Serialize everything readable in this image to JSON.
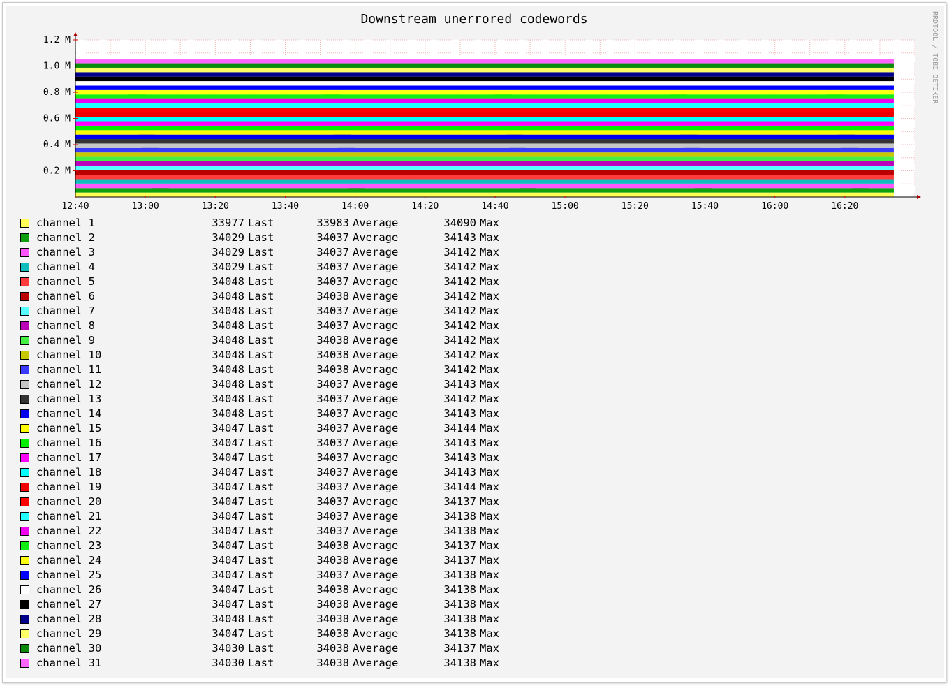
{
  "chart_data": {
    "type": "area",
    "title": "Downstream unerrored codewords",
    "side_label": "RRDTOOL / TOBI OETIKER",
    "y_ticks": [
      "1.2 M",
      "1.0 M",
      "0.8 M",
      "0.6 M",
      "0.4 M",
      "0.2 M"
    ],
    "x_ticks": [
      "12:40",
      "13:00",
      "13:20",
      "13:40",
      "14:00",
      "14:20",
      "14:40",
      "15:00",
      "15:20",
      "15:40",
      "16:00",
      "16:20"
    ],
    "ylim": [
      0,
      1200000
    ],
    "xlim": [
      "12:40",
      "16:40"
    ],
    "data_end": "16:34",
    "stacked": true,
    "grid": true,
    "legend_position": "bottom",
    "stat_labels": {
      "last": "Last",
      "average": "Average",
      "max": "Max"
    },
    "series": [
      {
        "name": "channel 1",
        "color": "#ffff55",
        "last": 33977,
        "average": 33983,
        "max": 34090
      },
      {
        "name": "channel 2",
        "color": "#0ca00c",
        "last": 34029,
        "average": 34037,
        "max": 34143
      },
      {
        "name": "channel 3",
        "color": "#ff55ff",
        "last": 34029,
        "average": 34037,
        "max": 34142
      },
      {
        "name": "channel 4",
        "color": "#10bcbc",
        "last": 34029,
        "average": 34037,
        "max": 34142
      },
      {
        "name": "channel 5",
        "color": "#ff3b3b",
        "last": 34048,
        "average": 34037,
        "max": 34142
      },
      {
        "name": "channel 6",
        "color": "#bb0000",
        "last": 34048,
        "average": 34038,
        "max": 34142
      },
      {
        "name": "channel 7",
        "color": "#55ffff",
        "last": 34048,
        "average": 34037,
        "max": 34142
      },
      {
        "name": "channel 8",
        "color": "#bb00bb",
        "last": 34048,
        "average": 34037,
        "max": 34142
      },
      {
        "name": "channel 9",
        "color": "#44ee44",
        "last": 34048,
        "average": 34038,
        "max": 34142
      },
      {
        "name": "channel 10",
        "color": "#c8c800",
        "last": 34048,
        "average": 34038,
        "max": 34142
      },
      {
        "name": "channel 11",
        "color": "#3a3aff",
        "last": 34048,
        "average": 34038,
        "max": 34142
      },
      {
        "name": "channel 12",
        "color": "#c6c6c6",
        "last": 34048,
        "average": 34037,
        "max": 34143
      },
      {
        "name": "channel 13",
        "color": "#333333",
        "last": 34048,
        "average": 34037,
        "max": 34142
      },
      {
        "name": "channel 14",
        "color": "#0000ee",
        "last": 34048,
        "average": 34037,
        "max": 34143
      },
      {
        "name": "channel 15",
        "color": "#ffff00",
        "last": 34047,
        "average": 34037,
        "max": 34144
      },
      {
        "name": "channel 16",
        "color": "#00ee00",
        "last": 34047,
        "average": 34037,
        "max": 34143
      },
      {
        "name": "channel 17",
        "color": "#ff00ff",
        "last": 34047,
        "average": 34037,
        "max": 34143
      },
      {
        "name": "channel 18",
        "color": "#00ffff",
        "last": 34047,
        "average": 34037,
        "max": 34143
      },
      {
        "name": "channel 19",
        "color": "#ee0000",
        "last": 34047,
        "average": 34037,
        "max": 34144
      },
      {
        "name": "channel 20",
        "color": "#ff0000",
        "last": 34047,
        "average": 34037,
        "max": 34137
      },
      {
        "name": "channel 21",
        "color": "#22ffff",
        "last": 34047,
        "average": 34037,
        "max": 34138
      },
      {
        "name": "channel 22",
        "color": "#ee00ee",
        "last": 34047,
        "average": 34037,
        "max": 34138
      },
      {
        "name": "channel 23",
        "color": "#11ee11",
        "last": 34047,
        "average": 34038,
        "max": 34137
      },
      {
        "name": "channel 24",
        "color": "#ffff11",
        "last": 34047,
        "average": 34038,
        "max": 34137
      },
      {
        "name": "channel 25",
        "color": "#0000ff",
        "last": 34047,
        "average": 34037,
        "max": 34138
      },
      {
        "name": "channel 26",
        "color": "#ffffff",
        "last": 34047,
        "average": 34038,
        "max": 34138
      },
      {
        "name": "channel 27",
        "color": "#000000",
        "last": 34047,
        "average": 34038,
        "max": 34138
      },
      {
        "name": "channel 28",
        "color": "#00008b",
        "last": 34048,
        "average": 34038,
        "max": 34138
      },
      {
        "name": "channel 29",
        "color": "#ffff66",
        "last": 34047,
        "average": 34038,
        "max": 34138
      },
      {
        "name": "channel 30",
        "color": "#0a8a0a",
        "last": 34030,
        "average": 34038,
        "max": 34137
      },
      {
        "name": "channel 31",
        "color": "#ff66ff",
        "last": 34030,
        "average": 34038,
        "max": 34138
      }
    ]
  }
}
